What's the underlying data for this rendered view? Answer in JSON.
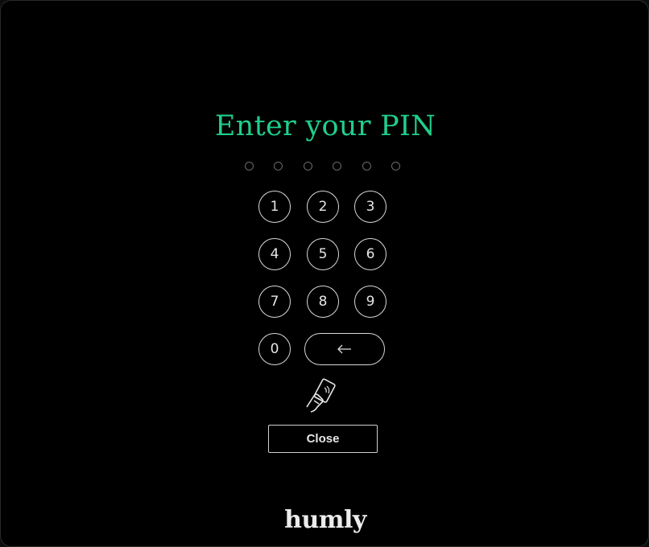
{
  "title": "Enter your PIN",
  "pin": {
    "length": 6,
    "entered": 0
  },
  "keypad": {
    "keys": [
      "1",
      "2",
      "3",
      "4",
      "5",
      "6",
      "7",
      "8",
      "9",
      "0"
    ],
    "backspace_icon": "arrow-left-icon"
  },
  "nfc_icon": "hand-card-tap-icon",
  "close_label": "Close",
  "brand": {
    "logo": "humly"
  },
  "colors": {
    "accent": "#1fcf8c",
    "background": "#000000",
    "foreground": "#e6e6e6"
  }
}
